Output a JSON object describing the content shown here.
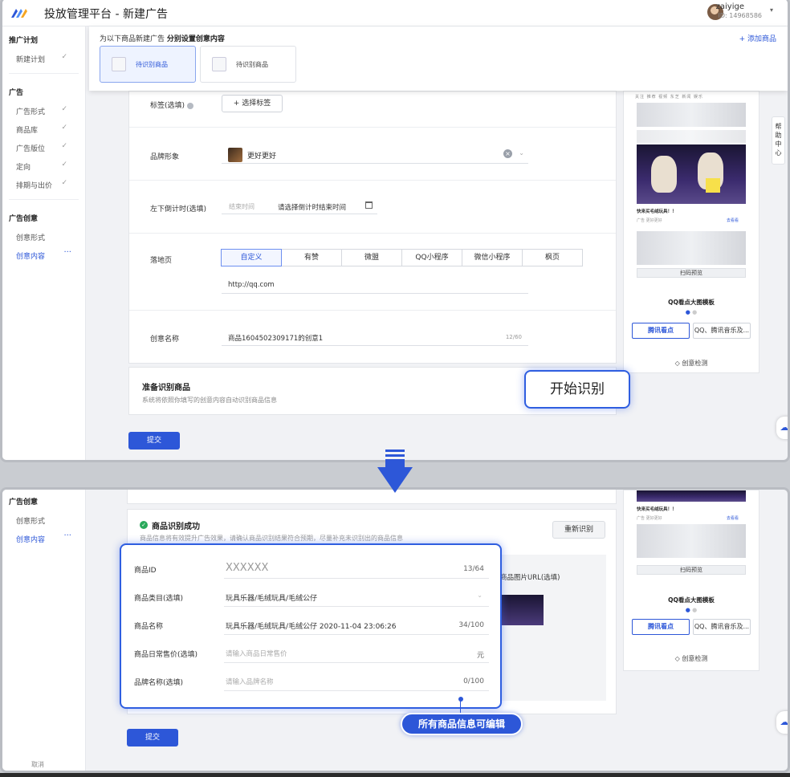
{
  "app": {
    "title": "投放管理平台 - 新建广告"
  },
  "user": {
    "name": "zaiyige",
    "id": "ID: 14968586"
  },
  "sidebar": {
    "sections": [
      {
        "title": "推广计划",
        "items": [
          {
            "label": "新建计划",
            "done": true
          }
        ]
      },
      {
        "title": "广告",
        "items": [
          {
            "label": "广告形式",
            "done": true
          },
          {
            "label": "商品库",
            "done": true
          },
          {
            "label": "广告版位",
            "done": true
          },
          {
            "label": "定向",
            "done": true
          },
          {
            "label": "排期与出价",
            "done": true
          }
        ]
      },
      {
        "title": "广告创意",
        "items": [
          {
            "label": "创意形式",
            "done": false
          },
          {
            "label": "创意内容",
            "done": false,
            "active": true
          }
        ]
      }
    ],
    "more": "···",
    "cancel": "取消"
  },
  "goods_panel": {
    "title": "为以下商品新建广告",
    "subtitle": "分别设置创意内容",
    "add": "+ 添加商品",
    "cards": [
      {
        "label": "待识别商品",
        "selected": true
      },
      {
        "label": "待识别商品",
        "selected": false
      }
    ]
  },
  "form": {
    "tag_label": "标签(选填)",
    "tag_button": "+ 选择标签",
    "brand_label": "品牌形象",
    "brand_value": "更好更好",
    "countdown_label": "左下倒计时(选填)",
    "countdown_placeholder": "结束时间",
    "countdown_value": "请选择倒计时结束时间",
    "landing_label": "落地页",
    "landing_options": [
      "自定义",
      "有赞",
      "微盟",
      "QQ小程序",
      "微信小程序",
      "枫页"
    ],
    "landing_selected": 0,
    "landing_url": "http://qq.com",
    "creative_name_label": "创意名称",
    "creative_name_value": "商品1604502309171的创意1",
    "creative_name_count": "12/60"
  },
  "prepare": {
    "title": "准备识别商品",
    "desc": "系统将依照你填写的创意内容自动识别商品信息"
  },
  "callout_start": "开始识别",
  "submit": "提交",
  "preview": {
    "tabs": "关注 推荐 视频 东芝 新闻 娱乐",
    "feed_text": "快来买毛绒玩具！！",
    "ad_tag": "广告 更好更好",
    "ad_link": "去看看",
    "scan": "扫码预览",
    "template": "QQ看点大图模板",
    "btn_kandian": "腾讯看点",
    "btn_qq": "QQ、腾讯音乐及...",
    "check": "创意检测"
  },
  "help": "帮助中心",
  "result": {
    "title": "商品识别成功",
    "desc": "商品信息将有效提升广告效果，请确认商品识别结果符合预期，尽量补充未识别出的商品信息",
    "redo": "重新识别",
    "image_url_label": "商品图片URL(选填)",
    "fields": [
      {
        "label": "商品ID",
        "value": "XXXXXX",
        "count": "13/64",
        "kind": "big"
      },
      {
        "label": "商品类目(选填)",
        "value": "玩具乐器/毛绒玩具/毛绒公仔",
        "kind": "select"
      },
      {
        "label": "商品名称",
        "value": "玩具乐器/毛绒玩具/毛绒公仔 2020-11-04 23:06:26",
        "count": "34/100",
        "kind": "text"
      },
      {
        "label": "商品日常售价(选填)",
        "placeholder": "请输入商品日常售价",
        "count": "元",
        "kind": "ph"
      },
      {
        "label": "品牌名称(选填)",
        "placeholder": "请输入品牌名称",
        "count": "0/100",
        "kind": "ph"
      }
    ]
  },
  "callout_edit": "所有商品信息可编辑",
  "colors": {
    "primary": "#2d57d8",
    "success": "#2aa95b"
  }
}
